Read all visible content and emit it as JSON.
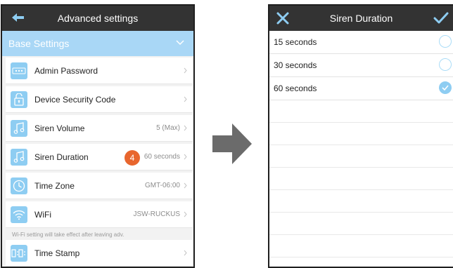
{
  "left_screen": {
    "title": "Advanced settings",
    "section_header": "Base Settings",
    "items": [
      {
        "label": "Admin Password",
        "value": ""
      },
      {
        "label": "Device Security Code",
        "value": ""
      },
      {
        "label": "Siren Volume",
        "value": "5 (Max)"
      },
      {
        "label": "Siren Duration",
        "value": "60 seconds"
      },
      {
        "label": "Time Zone",
        "value": "GMT-06:00"
      },
      {
        "label": "WiFi",
        "value": "JSW-RUCKUS"
      },
      {
        "label": "Time Stamp",
        "value": ""
      }
    ],
    "wifi_note": "Wi-Fi setting will take effect after leaving adv.",
    "step_badge": "4",
    "colors": {
      "titlebar": "#333333",
      "accent": "#a9d7f6",
      "badge": "#e8662e"
    }
  },
  "right_screen": {
    "title": "Siren Duration",
    "options": [
      {
        "label": "15 seconds",
        "selected": false
      },
      {
        "label": "30 seconds",
        "selected": false
      },
      {
        "label": "60 seconds",
        "selected": true
      }
    ]
  },
  "icons": {
    "back": "back-arrow-icon",
    "close": "close-icon",
    "confirm": "checkmark-icon",
    "transition": "right-arrow-icon"
  }
}
